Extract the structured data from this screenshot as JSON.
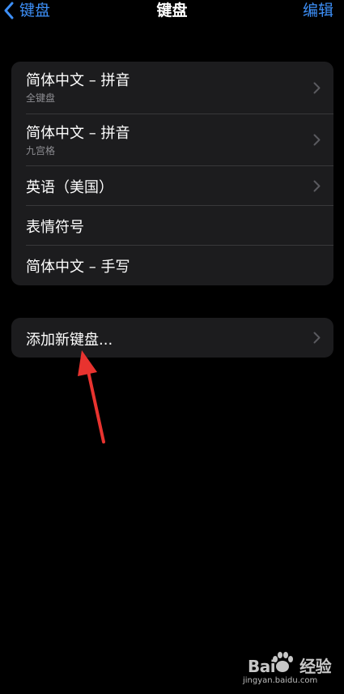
{
  "nav": {
    "back_label": "键盘",
    "title": "键盘",
    "edit_label": "编辑"
  },
  "keyboards": [
    {
      "title": "简体中文 – 拼音",
      "subtitle": "全键盘",
      "has_chevron": true
    },
    {
      "title": "简体中文 – 拼音",
      "subtitle": "九宫格",
      "has_chevron": true
    },
    {
      "title": "英语（美国）",
      "subtitle": "",
      "has_chevron": true
    },
    {
      "title": "表情符号",
      "subtitle": "",
      "has_chevron": false
    },
    {
      "title": "简体中文 – 手写",
      "subtitle": "",
      "has_chevron": false
    }
  ],
  "add_keyboard": {
    "label": "添加新键盘..."
  },
  "watermark": {
    "brand_prefix": "Bai",
    "brand_suffix": "经验",
    "url": "jingyan.baidu.com"
  },
  "colors": {
    "accent": "#3d8ff7",
    "background": "#000000",
    "cell": "#1c1c1e",
    "separator": "#38383a",
    "secondary_text": "#8d8d92",
    "annotation_arrow": "#e8332f"
  },
  "icons": {
    "back": "chevron-left-icon",
    "disclosure": "chevron-right-icon",
    "annotation": "red-arrow-icon"
  }
}
